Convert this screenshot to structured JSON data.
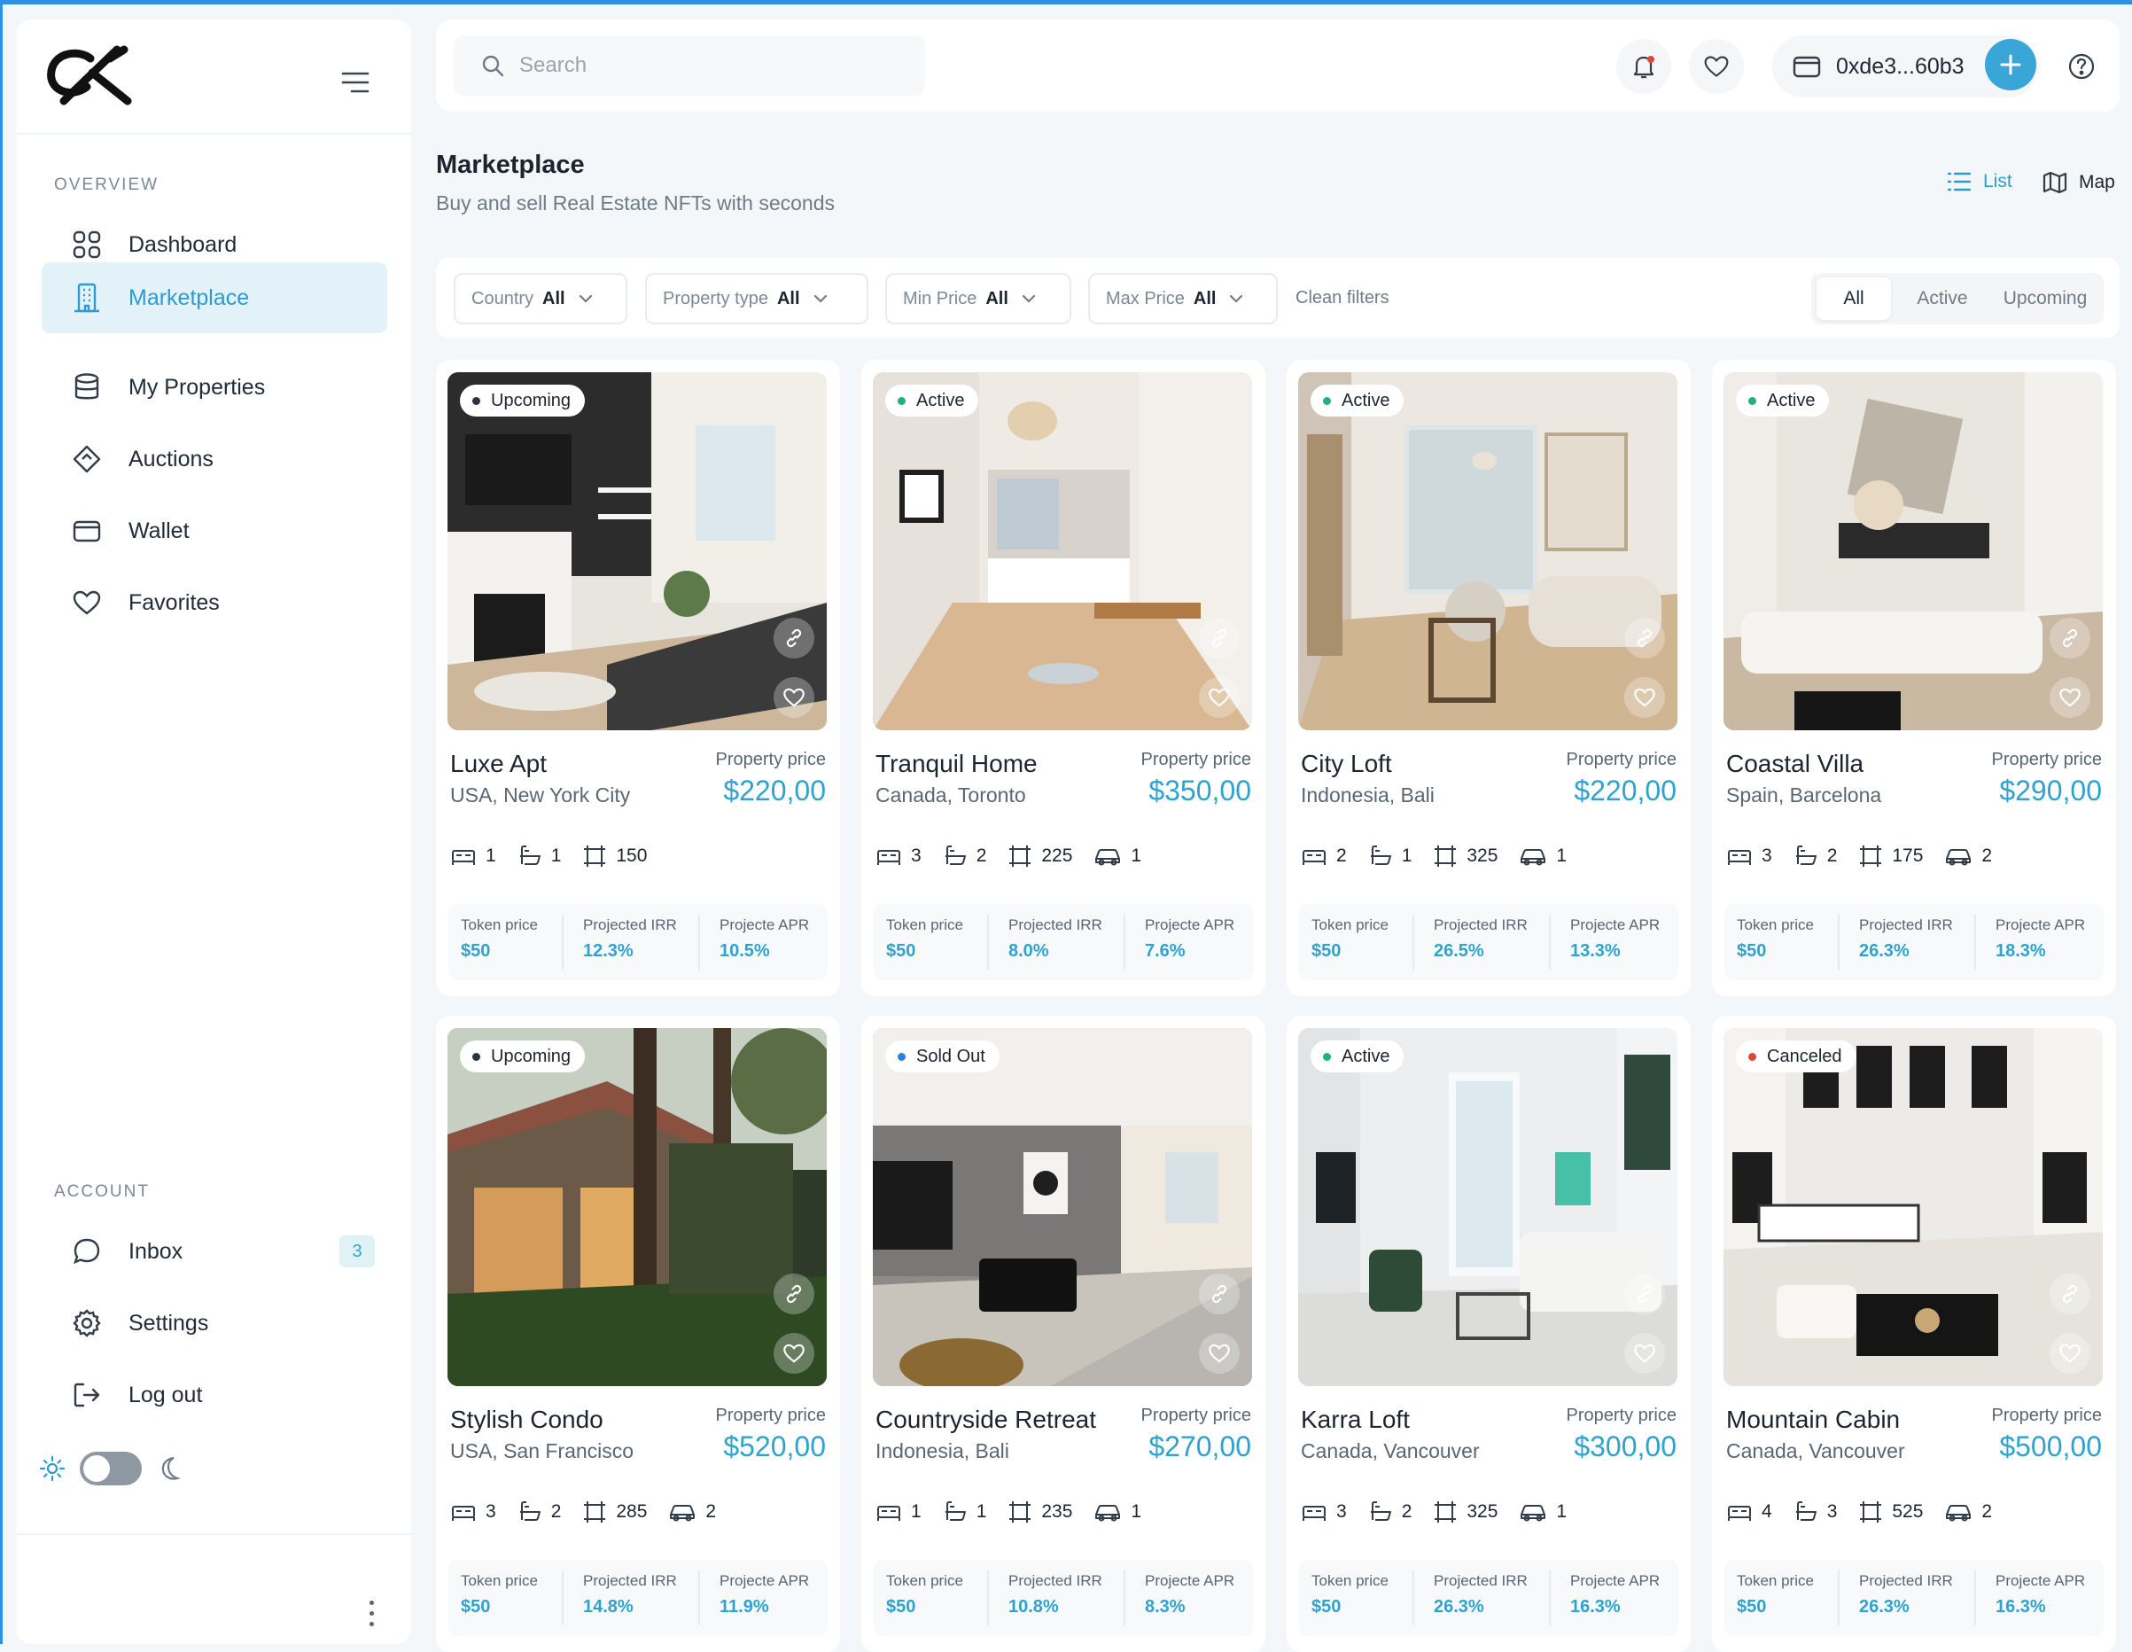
{
  "brand": {
    "logo_text": "CK"
  },
  "sidebar": {
    "overview_label": "OVERVIEW",
    "account_label": "ACCOUNT",
    "items": [
      {
        "label": "Dashboard",
        "icon": "grid-icon"
      },
      {
        "label": "Marketplace",
        "icon": "building-icon",
        "active": true
      },
      {
        "label": "My Properties",
        "icon": "database-icon"
      },
      {
        "label": "Auctions",
        "icon": "gavel-icon"
      },
      {
        "label": "Wallet",
        "icon": "wallet-icon"
      },
      {
        "label": "Favorites",
        "icon": "heart-icon"
      }
    ],
    "account_items": [
      {
        "label": "Inbox",
        "icon": "chat-icon",
        "badge": "3"
      },
      {
        "label": "Settings",
        "icon": "gear-icon"
      },
      {
        "label": "Log out",
        "icon": "logout-icon"
      }
    ]
  },
  "topbar": {
    "search_placeholder": "Search",
    "wallet_address": "0xde3...60b3"
  },
  "page": {
    "title": "Marketplace",
    "subtitle": "Buy and sell Real Estate NFTs with seconds",
    "view_list": "List",
    "view_map": "Map"
  },
  "filters": {
    "country": {
      "label": "Country",
      "value": "All"
    },
    "property_type": {
      "label": "Property type",
      "value": "All"
    },
    "min_price": {
      "label": "Min Price",
      "value": "All"
    },
    "max_price": {
      "label": "Max Price",
      "value": "All"
    },
    "clean": "Clean filters",
    "status_tabs": [
      "All",
      "Active",
      "Upcoming"
    ],
    "selected_status": "All"
  },
  "labels": {
    "property_price": "Property price",
    "token_price": "Token price",
    "projected_irr": "Projected IRR",
    "projected_apr": "Projecte APR"
  },
  "status_colors": {
    "Upcoming": "#2b3340",
    "Active": "#22b07d",
    "Sold Out": "#2f7fe0",
    "Canceled": "#e0473a"
  },
  "accent_color": "#2fa3cf",
  "properties": [
    {
      "status": "Upcoming",
      "name": "Luxe Apt",
      "location": "USA, New York City",
      "price": "$220,00",
      "beds": "1",
      "baths": "1",
      "area": "150",
      "cars": "",
      "token_price": "$50",
      "irr": "12.3%",
      "apr": "10.5%"
    },
    {
      "status": "Active",
      "name": "Tranquil Home",
      "location": "Canada, Toronto",
      "price": "$350,00",
      "beds": "3",
      "baths": "2",
      "area": "225",
      "cars": "1",
      "token_price": "$50",
      "irr": "8.0%",
      "apr": "7.6%"
    },
    {
      "status": "Active",
      "name": "City Loft",
      "location": "Indonesia, Bali",
      "price": "$220,00",
      "beds": "2",
      "baths": "1",
      "area": "325",
      "cars": "1",
      "token_price": "$50",
      "irr": "26.5%",
      "apr": "13.3%"
    },
    {
      "status": "Active",
      "name": "Coastal Villa",
      "location": "Spain, Barcelona",
      "price": "$290,00",
      "beds": "3",
      "baths": "2",
      "area": "175",
      "cars": "2",
      "token_price": "$50",
      "irr": "26.3%",
      "apr": "18.3%"
    },
    {
      "status": "Upcoming",
      "name": "Stylish Condo",
      "location": "USA, San Francisco",
      "price": "$520,00",
      "beds": "3",
      "baths": "2",
      "area": "285",
      "cars": "2",
      "token_price": "$50",
      "irr": "14.8%",
      "apr": "11.9%"
    },
    {
      "status": "Sold Out",
      "name": "Countryside Retreat",
      "location": "Indonesia, Bali",
      "price": "$270,00",
      "beds": "1",
      "baths": "1",
      "area": "235",
      "cars": "1",
      "token_price": "$50",
      "irr": "10.8%",
      "apr": "8.3%"
    },
    {
      "status": "Active",
      "name": "Karra Loft",
      "location": "Canada, Vancouver",
      "price": "$300,00",
      "beds": "3",
      "baths": "2",
      "area": "325",
      "cars": "1",
      "token_price": "$50",
      "irr": "26.3%",
      "apr": "16.3%"
    },
    {
      "status": "Canceled",
      "name": "Mountain Cabin",
      "location": "Canada, Vancouver",
      "price": "$500,00",
      "beds": "4",
      "baths": "3",
      "area": "525",
      "cars": "2",
      "token_price": "$50",
      "irr": "26.3%",
      "apr": "16.3%"
    }
  ]
}
